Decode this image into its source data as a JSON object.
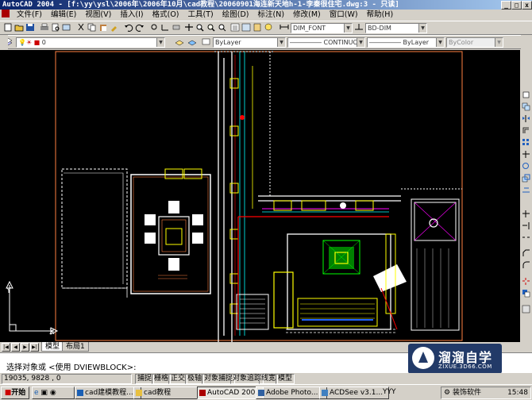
{
  "window": {
    "title": "AutoCAD 2004 - [f:\\yy\\ysl\\2006年\\2006年10月\\cad教程\\20060901海连新天地h-1-李秦很住宅.dwg:3 - 只读]",
    "controls": [
      "_",
      "□",
      "x"
    ]
  },
  "menu": {
    "items": [
      "文件(F)",
      "编辑(E)",
      "视图(V)",
      "插入(I)",
      "格式(O)",
      "工具(T)",
      "绘图(D)",
      "标注(N)",
      "修改(M)",
      "窗口(W)",
      "帮助(H)"
    ]
  },
  "toolbar": {
    "dimstyle": "DIM_FONT",
    "dimstyle2": "BD-DIM",
    "layer": "0",
    "color": "ByLayer",
    "linetype": "CONTINUOUS",
    "lineweight": "ByLayer",
    "plotstyle": "ByColor"
  },
  "tabs": {
    "model": "模型",
    "layout": "布局1"
  },
  "command": {
    "line1": "",
    "line2": "选择对象或 <使用 DVIEWBLOCK>:"
  },
  "status": {
    "coords": "19035, 9828 , 0",
    "buttons": [
      "捕捉",
      "栅格",
      "正交",
      "极轴",
      "对象捕捉",
      "对象追踪",
      "线宽",
      "模型"
    ]
  },
  "taskbar": {
    "start": "开始",
    "tasks": [
      "cad建模教程...",
      "cad教程",
      "AutoCAD 200...",
      "Adobe Photo...",
      "ACDSee v3.1...",
      "YYY"
    ],
    "tray_text": "装饰软件",
    "clock": "15:48"
  },
  "watermark": {
    "main": "溜溜自学",
    "sub": "ZIXUE.3D66.COM"
  },
  "ucs": {
    "x_label": "X",
    "y_label": "Y"
  },
  "colors": {
    "titlebar_start": "#0a246a",
    "canvas": "#000000",
    "frame": "#ff8040",
    "wall_white": "#ffffff",
    "cyan": "#00ffff",
    "yellow": "#ffff00",
    "red": "#ff0000",
    "green": "#00ff00",
    "magenta": "#ff00ff"
  }
}
